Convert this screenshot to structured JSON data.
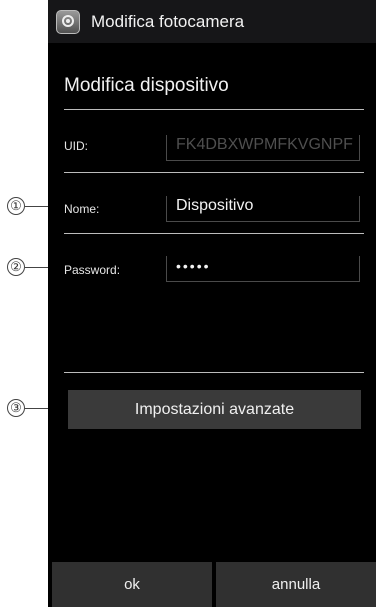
{
  "app": {
    "title": "Modifica fotocamera"
  },
  "dialog": {
    "title": "Modifica dispositivo",
    "uid": {
      "label": "UID:",
      "value": "FK4DBXWPMFKVGNPF"
    },
    "name": {
      "label": "Nome:",
      "value": "Dispositivo"
    },
    "password": {
      "label": "Password:",
      "masked_value": "•••••"
    },
    "advanced_button": "Impostazioni avanzate",
    "ok_button": "ok",
    "cancel_button": "annulla"
  },
  "callouts": [
    "①",
    "②",
    "③"
  ]
}
